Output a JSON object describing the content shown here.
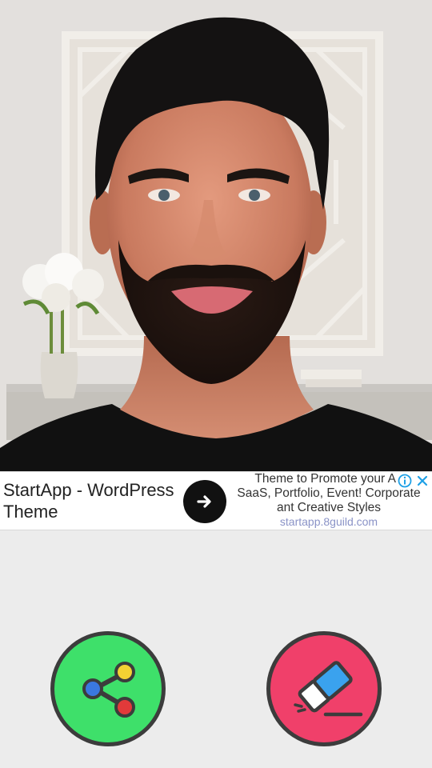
{
  "ad": {
    "title": "StartApp - WordPress Theme",
    "body_line1": "Theme to Promote your Ap",
    "body_line2": "SaaS, Portfolio, Event! Corporate",
    "body_line3": "ant Creative Styles",
    "url": "startapp.8guild.com"
  },
  "icons": {
    "ad_arrow": "arrow-right-icon",
    "ad_info": "info-icon",
    "ad_close": "close-icon",
    "share": "share-icon",
    "eraser": "eraser-icon"
  },
  "colors": {
    "share_button": "#3ee06a",
    "eraser_button": "#f0406a",
    "button_border": "#3c3c3c",
    "ad_url": "#8a93c7",
    "ad_icons": "#1ea0e6"
  }
}
